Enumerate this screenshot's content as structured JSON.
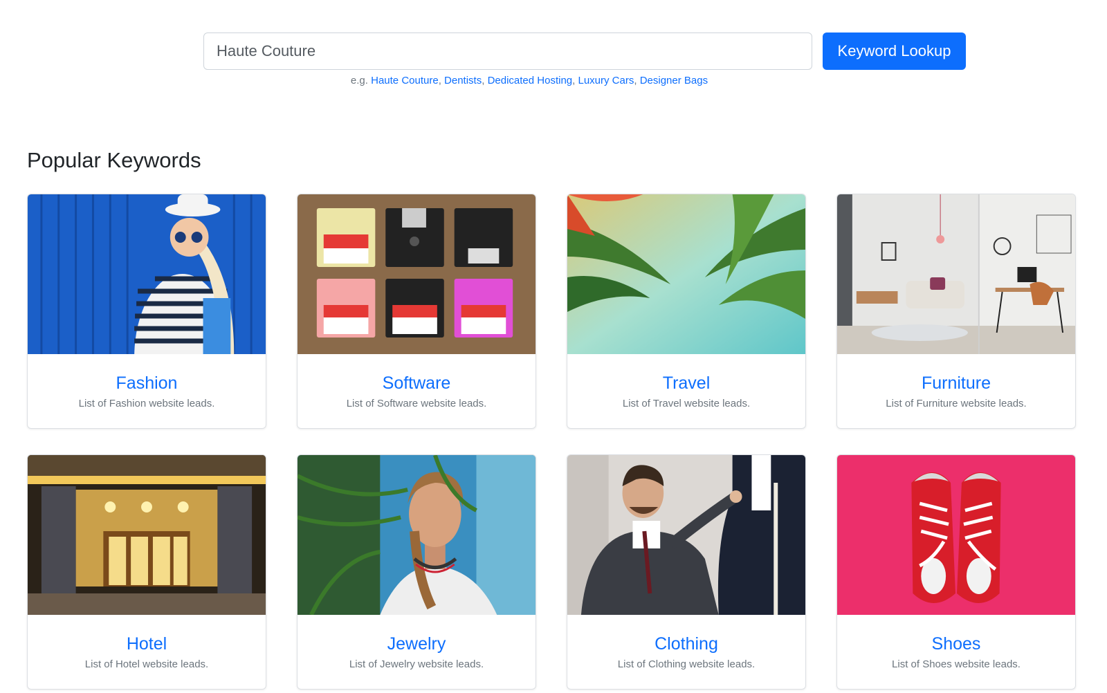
{
  "search": {
    "placeholder": "Haute Couture",
    "button_label": "Keyword Lookup",
    "examples_prefix": "e.g.",
    "examples": [
      "Haute Couture",
      "Dentists",
      "Dedicated Hosting",
      "Luxury Cars",
      "Designer Bags"
    ]
  },
  "section": {
    "title": "Popular Keywords"
  },
  "cards": [
    {
      "title": "Fashion",
      "desc": "List of Fashion website leads.",
      "image": "fashion-photo"
    },
    {
      "title": "Software",
      "desc": "List of Software website leads.",
      "image": "floppy-disks-photo"
    },
    {
      "title": "Travel",
      "desc": "List of Travel website leads.",
      "image": "palm-trees-photo"
    },
    {
      "title": "Furniture",
      "desc": "List of Furniture website leads.",
      "image": "living-room-photo"
    },
    {
      "title": "Hotel",
      "desc": "List of Hotel website leads.",
      "image": "hotel-entrance-photo"
    },
    {
      "title": "Jewelry",
      "desc": "List of Jewelry website leads.",
      "image": "woman-with-necklace-photo"
    },
    {
      "title": "Clothing",
      "desc": "List of Clothing website leads.",
      "image": "tailor-fitting-photo"
    },
    {
      "title": "Shoes",
      "desc": "List of Shoes website leads.",
      "image": "red-sneakers-photo"
    }
  ],
  "colors": {
    "accent": "#0d6efd",
    "muted": "#6c757d",
    "border": "#dcdfe3"
  }
}
